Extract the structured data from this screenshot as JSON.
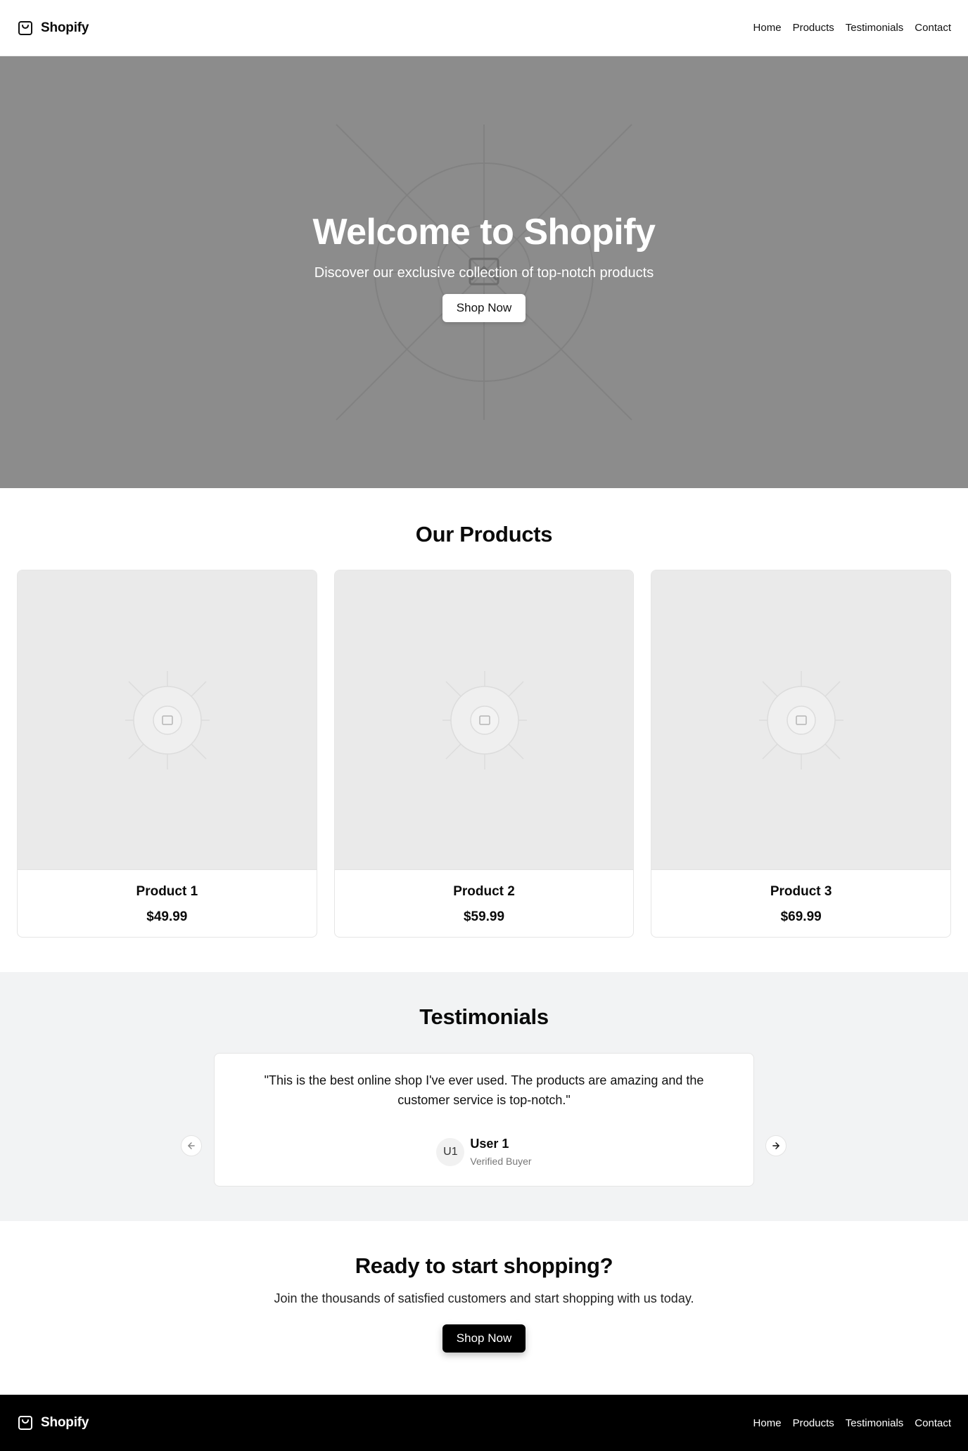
{
  "header": {
    "brand": "Shopify",
    "nav": [
      "Home",
      "Products",
      "Testimonials",
      "Contact"
    ]
  },
  "hero": {
    "title": "Welcome to Shopify",
    "subtitle": "Discover our exclusive collection of top-notch products",
    "button": "Shop Now",
    "icon": "image-placeholder-icon"
  },
  "products": {
    "title": "Our Products",
    "items": [
      {
        "name": "Product 1",
        "price": "$49.99"
      },
      {
        "name": "Product 2",
        "price": "$59.99"
      },
      {
        "name": "Product 3",
        "price": "$69.99"
      }
    ]
  },
  "testimonials": {
    "title": "Testimonials",
    "quote": "\"This is the best online shop I've ever used. The products are amazing and the customer service is top-notch.\"",
    "avatar": "U1",
    "name": "User 1",
    "role": "Verified Buyer"
  },
  "cta": {
    "title": "Ready to start shopping?",
    "subtitle": "Join the thousands of satisfied customers and start shopping with us today.",
    "button": "Shop Now"
  },
  "footer": {
    "brand": "Shopify",
    "nav": [
      "Home",
      "Products",
      "Testimonials",
      "Contact"
    ]
  },
  "colors": {
    "hero_bg": "#8c8c8c",
    "testimonials_bg": "#f2f3f4",
    "footer_bg": "#000000",
    "cta_button": "#000000"
  }
}
